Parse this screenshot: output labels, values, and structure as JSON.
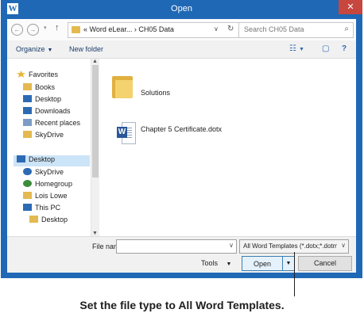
{
  "window": {
    "title": "Open",
    "close_glyph": "✕",
    "app_icon_letter": "W"
  },
  "nav": {
    "back_glyph": "←",
    "forward_glyph": "→",
    "dropdown_glyph": "▾",
    "up_glyph": "↑",
    "address_text": "« Word eLear... › CH05 Data",
    "address_dropdown_glyph": "∨",
    "refresh_glyph": "↻",
    "search_placeholder": "Search CH05 Data",
    "search_glyph": "⌕"
  },
  "toolbar": {
    "organize_label": "Organize",
    "new_folder_label": "New folder",
    "caret_glyph": "▼",
    "views_glyph": "☷",
    "preview_glyph": "▢",
    "help_glyph": "?"
  },
  "sidebar": {
    "items": [
      {
        "label": "Favorites",
        "icon": "star-icon",
        "color": "#e8b637"
      },
      {
        "label": "Books",
        "icon": "folder-icon",
        "color": "#e4b94f"
      },
      {
        "label": "Desktop",
        "icon": "desktop-icon",
        "color": "#2d6ab4"
      },
      {
        "label": "Downloads",
        "icon": "downloads-icon",
        "color": "#2d6ab4"
      },
      {
        "label": "Recent places",
        "icon": "recent-places-icon",
        "color": "#7a9cc6"
      },
      {
        "label": "SkyDrive",
        "icon": "skydrive-folder-icon",
        "color": "#e4b94f"
      },
      {
        "label": "Desktop",
        "icon": "desktop-icon",
        "color": "#2d6ab4",
        "selected": true
      },
      {
        "label": "SkyDrive",
        "icon": "cloud-icon",
        "color": "#2d6ab4"
      },
      {
        "label": "Homegroup",
        "icon": "homegroup-icon",
        "color": "#3c8c3c"
      },
      {
        "label": "Lois Lowe",
        "icon": "user-folder-icon",
        "color": "#e4b94f"
      },
      {
        "label": "This PC",
        "icon": "computer-icon",
        "color": "#2d6ab4"
      },
      {
        "label": "Desktop",
        "icon": "folder-icon",
        "color": "#e4b94f"
      }
    ]
  },
  "files": {
    "items": [
      {
        "name": "Solutions",
        "type": "folder"
      },
      {
        "name": "Chapter 5 Certificate.dotx",
        "type": "word-template"
      }
    ]
  },
  "bottom": {
    "file_name_label": "File name:",
    "file_name_value": "",
    "file_type_value": "All Word Templates (*.dotx;*.dotm;*.doc...",
    "dropdown_glyph": "∨",
    "tools_label": "Tools",
    "tools_caret": "▼",
    "open_label": "Open",
    "open_split_glyph": "▼",
    "cancel_label": "Cancel"
  },
  "caption": "Set the file type to All Word Templates."
}
